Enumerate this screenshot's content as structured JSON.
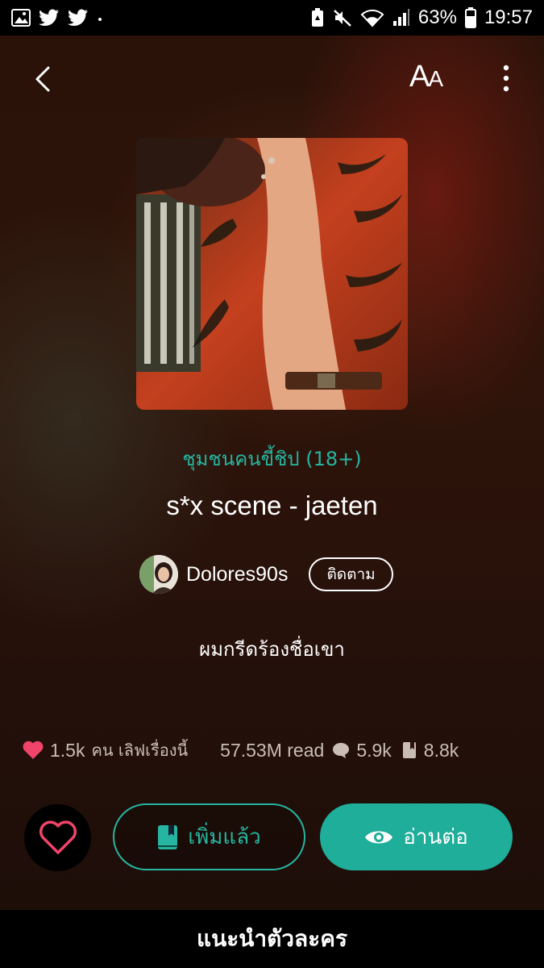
{
  "status_bar": {
    "battery_percent": "63%",
    "time": "19:57",
    "left_icons": [
      "gallery-icon",
      "twitter-icon",
      "twitter-icon",
      "dot-icon"
    ],
    "right_icons": [
      "battery-saver-icon",
      "mute-icon",
      "wifi-icon",
      "signal-icon",
      "battery-icon"
    ]
  },
  "header": {
    "font_size_label_big": "A",
    "font_size_label_small": "A",
    "icons": [
      "back-icon",
      "font-size-icon",
      "more-vertical-icon"
    ]
  },
  "story": {
    "category": "ชุมชนคนขี้ชิป  (18+)",
    "title": "s*x scene - jaeten",
    "author": "Dolores90s",
    "follow_label": "ติดตาม",
    "description": "ผมกรีดร้องชื่อเขา"
  },
  "stats": {
    "likes": "1.5k",
    "likes_label": "คน เลิฟเรื่องนี้",
    "reads": "57.53M read",
    "comments": "5.9k",
    "bookmarks": "8.8k"
  },
  "actions": {
    "added_label": "เพิ่มแล้ว",
    "read_label": "อ่านต่อ"
  },
  "bottom_bar": {
    "label": "แนะนำตัวละคร"
  },
  "colors": {
    "accent": "#26b5a0",
    "heart": "#f0446a",
    "background": "#2a1209"
  }
}
